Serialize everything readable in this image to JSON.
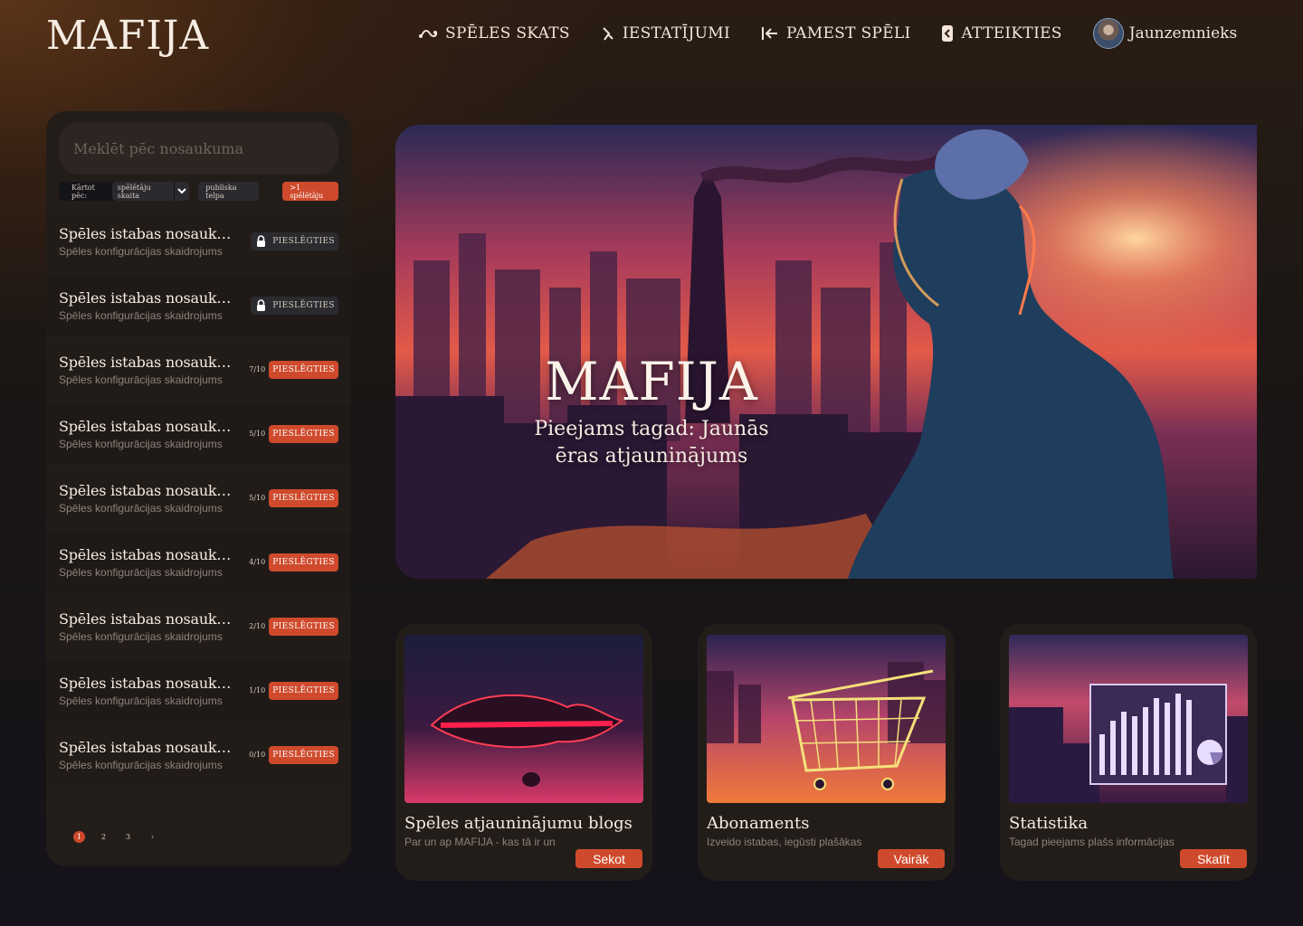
{
  "brand": {
    "logo": "MAFIJA"
  },
  "nav": {
    "items": [
      {
        "label": "SPĒLES SKATS",
        "icon": "game-view-icon"
      },
      {
        "label": "IESTATĪJUMI",
        "icon": "settings-icon"
      },
      {
        "label": "PAMEST SPĒLI",
        "icon": "leave-game-icon"
      },
      {
        "label": "ATTEIKTIES",
        "icon": "logout-icon"
      }
    ],
    "user": {
      "name": "Jaunzemnieks"
    }
  },
  "sidebar": {
    "search_placeholder": "Meklēt pēc nosaukuma",
    "sort_label": "Kārtot pēc:",
    "sort_value": "spēlētāju skaita",
    "filter_public": "publiska telpa",
    "filter_players": ">1 spēlētāju",
    "rooms": [
      {
        "name": "Spēles istabas nosaukums I",
        "desc": "Spēles konfigurācijas skaidrojums",
        "count": "",
        "action": "PIESLĒGTIES",
        "locked": true
      },
      {
        "name": "Spēles istabas nosaukums II",
        "desc": "Spēles konfigurācijas skaidrojums",
        "count": "",
        "action": "PIESLĒGTIES",
        "locked": true
      },
      {
        "name": "Spēles istabas nosaukums III",
        "desc": "Spēles konfigurācijas skaidrojums",
        "count": "7/10",
        "action": "PIESLĒGTIES",
        "locked": false
      },
      {
        "name": "Spēles istabas nosaukums IV",
        "desc": "Spēles konfigurācijas skaidrojums",
        "count": "5/10",
        "action": "PIESLĒGTIES",
        "locked": false
      },
      {
        "name": "Spēles istabas nosaukums V",
        "desc": "Spēles konfigurācijas skaidrojums",
        "count": "5/10",
        "action": "PIESLĒGTIES",
        "locked": false
      },
      {
        "name": "Spēles istabas nosaukums VI",
        "desc": "Spēles konfigurācijas skaidrojums",
        "count": "4/10",
        "action": "PIESLĒGTIES",
        "locked": false
      },
      {
        "name": "Spēles istabas nosaukums VII",
        "desc": "Spēles konfigurācijas skaidrojums",
        "count": "2/10",
        "action": "PIESLĒGTIES",
        "locked": false
      },
      {
        "name": "Spēles istabas nosaukums VIII",
        "desc": "Spēles konfigurācijas skaidrojums",
        "count": "1/10",
        "action": "PIESLĒGTIES",
        "locked": false
      },
      {
        "name": "Spēles istabas nosaukums IX",
        "desc": "Spēles konfigurācijas skaidrojums",
        "count": "0/10",
        "action": "PIESLĒGTIES",
        "locked": false
      }
    ],
    "pages": [
      "1",
      "2",
      "3",
      "›"
    ]
  },
  "hero": {
    "title": "MAFIJA",
    "subtitle": "Pieejams tagad: Jaunās ēras atjauninājums"
  },
  "cards": [
    {
      "title": "Spēles atjauninājumu blogs",
      "desc": "Par un ap MAFIJA - kas tā ir un",
      "button": "Sekot"
    },
    {
      "title": "Abonaments",
      "desc": "Izveido istabas, iegūsti plašākas",
      "button": "Vairāk"
    },
    {
      "title": "Statistika",
      "desc": "Tagad pieejams plašs informācijas",
      "button": "Skatīt"
    }
  ],
  "colors": {
    "accent": "#cf4a2c",
    "panel": "#231d1a",
    "background": "#14121a"
  }
}
